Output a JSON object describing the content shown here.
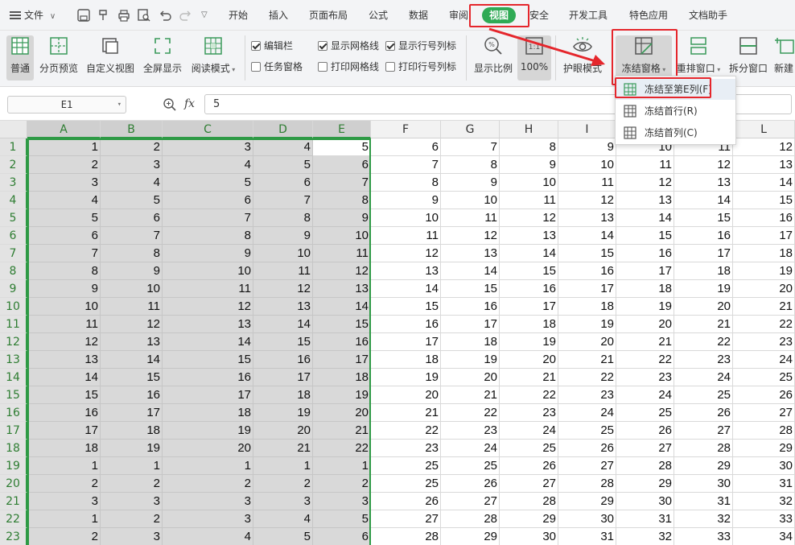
{
  "menubar": {
    "file": "文件",
    "tabs": [
      "开始",
      "插入",
      "页面布局",
      "公式",
      "数据",
      "审阅",
      "视图",
      "安全",
      "开发工具",
      "特色应用",
      "文档助手"
    ],
    "active_tab": "视图"
  },
  "ribbon": {
    "normal": "普通",
    "page_break": "分页预览",
    "custom_view": "自定义视图",
    "fullscreen": "全屏显示",
    "reading_mode": "阅读模式",
    "edit_bar": "编辑栏",
    "task_pane": "任务窗格",
    "show_gridlines": "显示网格线",
    "print_gridlines": "打印网格线",
    "show_headings": "显示行号列标",
    "print_headings": "打印行号列标",
    "zoom": "显示比例",
    "zoom_100": "100%",
    "eye_mode": "护眼模式",
    "freeze": "冻结窗格",
    "rearrange": "重排窗口",
    "split": "拆分窗口",
    "new_window": "新建"
  },
  "checkboxes": {
    "edit_bar": true,
    "task_pane": false,
    "show_gridlines": true,
    "print_gridlines": false,
    "show_headings": true,
    "print_headings": false
  },
  "formula_bar": {
    "namebox": "E1",
    "fx": "fx",
    "value": "5"
  },
  "dropdown": {
    "items": [
      "冻结至第E列(F)",
      "冻结首行(R)",
      "冻结首列(C)"
    ]
  },
  "columns": [
    "A",
    "B",
    "C",
    "D",
    "E",
    "F",
    "G",
    "H",
    "I",
    "J",
    "K",
    "L"
  ],
  "rows": [
    [
      1,
      2,
      3,
      4,
      5,
      6,
      7,
      8,
      9,
      10,
      11,
      12
    ],
    [
      2,
      3,
      4,
      5,
      6,
      7,
      8,
      9,
      10,
      11,
      12,
      13
    ],
    [
      3,
      4,
      5,
      6,
      7,
      8,
      9,
      10,
      11,
      12,
      13,
      14
    ],
    [
      4,
      5,
      6,
      7,
      8,
      9,
      10,
      11,
      12,
      13,
      14,
      15
    ],
    [
      5,
      6,
      7,
      8,
      9,
      10,
      11,
      12,
      13,
      14,
      15,
      16
    ],
    [
      6,
      7,
      8,
      9,
      10,
      11,
      12,
      13,
      14,
      15,
      16,
      17
    ],
    [
      7,
      8,
      9,
      10,
      11,
      12,
      13,
      14,
      15,
      16,
      17,
      18
    ],
    [
      8,
      9,
      10,
      11,
      12,
      13,
      14,
      15,
      16,
      17,
      18,
      19
    ],
    [
      9,
      10,
      11,
      12,
      13,
      14,
      15,
      16,
      17,
      18,
      19,
      20
    ],
    [
      10,
      11,
      12,
      13,
      14,
      15,
      16,
      17,
      18,
      19,
      20,
      21
    ],
    [
      11,
      12,
      13,
      14,
      15,
      16,
      17,
      18,
      19,
      20,
      21,
      22
    ],
    [
      12,
      13,
      14,
      15,
      16,
      17,
      18,
      19,
      20,
      21,
      22,
      23
    ],
    [
      13,
      14,
      15,
      16,
      17,
      18,
      19,
      20,
      21,
      22,
      23,
      24
    ],
    [
      14,
      15,
      16,
      17,
      18,
      19,
      20,
      21,
      22,
      23,
      24,
      25
    ],
    [
      15,
      16,
      17,
      18,
      19,
      20,
      21,
      22,
      23,
      24,
      25,
      26
    ],
    [
      16,
      17,
      18,
      19,
      20,
      21,
      22,
      23,
      24,
      25,
      26,
      27
    ],
    [
      17,
      18,
      19,
      20,
      21,
      22,
      23,
      24,
      25,
      26,
      27,
      28
    ],
    [
      18,
      19,
      20,
      21,
      22,
      23,
      24,
      25,
      26,
      27,
      28,
      29
    ],
    [
      1,
      1,
      1,
      1,
      1,
      25,
      25,
      26,
      27,
      28,
      29,
      30
    ],
    [
      2,
      2,
      2,
      2,
      2,
      25,
      26,
      27,
      28,
      29,
      30,
      31
    ],
    [
      3,
      3,
      3,
      3,
      3,
      26,
      27,
      28,
      29,
      30,
      31,
      32
    ],
    [
      1,
      2,
      3,
      4,
      5,
      27,
      28,
      29,
      30,
      31,
      32,
      33
    ],
    [
      2,
      3,
      4,
      5,
      6,
      28,
      29,
      30,
      31,
      32,
      33,
      34
    ]
  ],
  "colors": {
    "accent_green": "#2faa55",
    "highlight_red": "#e5262c",
    "selection_gray": "#d9d9d9"
  }
}
